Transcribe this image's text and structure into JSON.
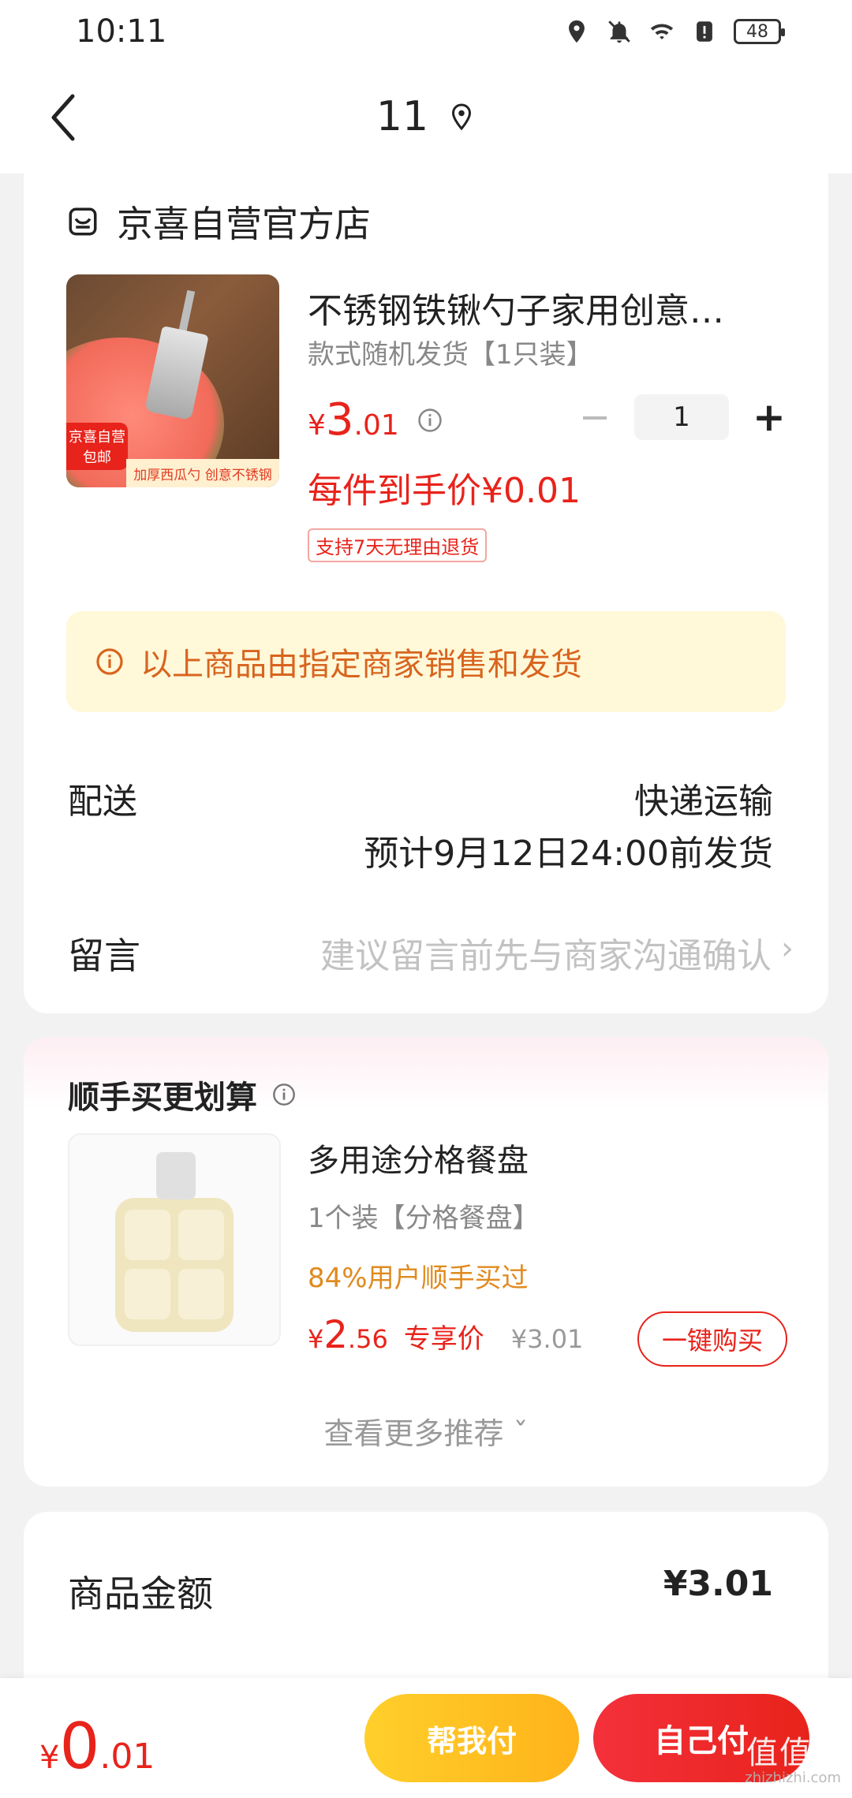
{
  "status_bar": {
    "time": "10:11",
    "battery": "48"
  },
  "header": {
    "title": "11"
  },
  "store": {
    "name": "京喜自营官方店"
  },
  "product": {
    "title": "不锈钢铁锹勺子家用创意…",
    "spec": "款式随机发货【1只装】",
    "price_yen": "¥",
    "price_int": "3",
    "price_dec": ".01",
    "quantity": "1",
    "unit_price": "每件到手价¥0.01",
    "return_policy": "支持7天无理由退货",
    "image_tag_left": "京喜自营 包邮",
    "image_tag_bottom": "加厚西瓜勺 创意不锈钢"
  },
  "notice": {
    "text": "以上商品由指定商家销售和发货"
  },
  "delivery": {
    "label": "配送",
    "type": "快递运输",
    "eta": "预计9月12日24:00前发货"
  },
  "message": {
    "label": "留言",
    "placeholder": "建议留言前先与商家沟通确认"
  },
  "recommendation": {
    "title": "顺手买更划算",
    "item_name": "多用途分格餐盘",
    "item_spec": "1个装【分格餐盘】",
    "item_stat": "84%用户顺手买过",
    "price_yen": "¥",
    "price_int": "2",
    "price_dec": ".56",
    "exclusive_label": "专享价",
    "original_price": "¥3.01",
    "buy_button": "一键购买",
    "more_label": "查看更多推荐"
  },
  "summary": {
    "goods_amount_label": "商品金额",
    "goods_amount_value": "¥3.01"
  },
  "bottom_bar": {
    "total_yen": "¥",
    "total_int": "0",
    "total_dec": ".01",
    "help_pay": "帮我付",
    "self_pay": "自己付"
  },
  "watermark": {
    "text": "值值值",
    "sub": "zhizhizhi.com"
  },
  "colors": {
    "accent_red": "#e8231b",
    "notice_bg": "#fff8d9",
    "notice_text": "#d8641e",
    "help_pay_yellow": "#ffc224"
  }
}
